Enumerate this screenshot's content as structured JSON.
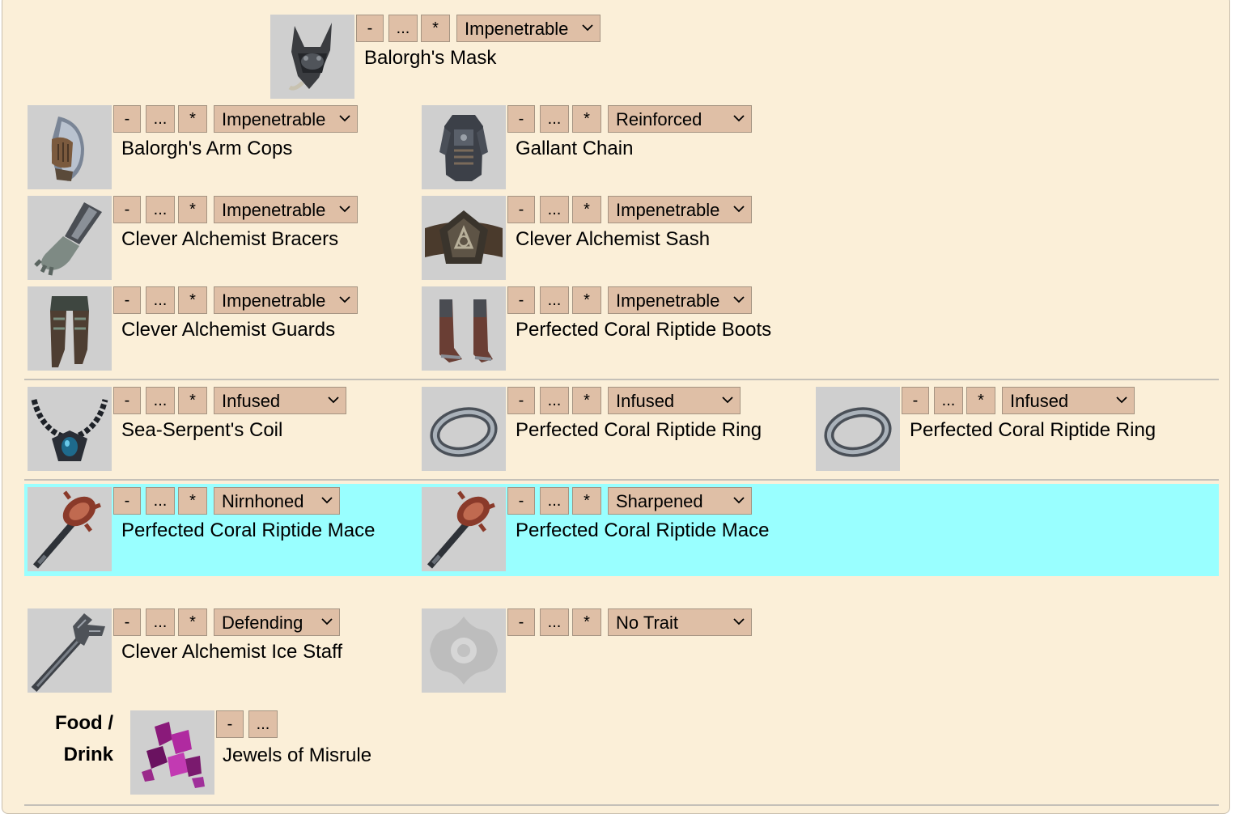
{
  "controls": {
    "remove_label": "-",
    "more_label": "...",
    "star_label": "*"
  },
  "slots": {
    "head": {
      "name": "Balorgh's Mask",
      "trait": "Impenetrable",
      "icon": "mask-icon"
    },
    "shoulders": {
      "name": "Balorgh's Arm Cops",
      "trait": "Impenetrable",
      "icon": "pauldron-icon"
    },
    "chest": {
      "name": "Gallant Chain",
      "trait": "Reinforced",
      "icon": "chest-armor-icon"
    },
    "hands": {
      "name": "Clever Alchemist Bracers",
      "trait": "Impenetrable",
      "icon": "gauntlet-icon"
    },
    "waist": {
      "name": "Clever Alchemist Sash",
      "trait": "Impenetrable",
      "icon": "belt-icon"
    },
    "legs": {
      "name": "Clever Alchemist Guards",
      "trait": "Impenetrable",
      "icon": "greaves-icon"
    },
    "feet": {
      "name": "Perfected Coral Riptide Boots",
      "trait": "Impenetrable",
      "icon": "boots-icon"
    },
    "neck": {
      "name": "Sea-Serpent's Coil",
      "trait": "Infused",
      "icon": "necklace-icon"
    },
    "ring1": {
      "name": "Perfected Coral Riptide Ring",
      "trait": "Infused",
      "icon": "ring-icon"
    },
    "ring2": {
      "name": "Perfected Coral Riptide Ring",
      "trait": "Infused",
      "icon": "ring-icon"
    },
    "main_hand": {
      "name": "Perfected Coral Riptide Mace",
      "trait": "Nirnhoned",
      "icon": "mace-icon"
    },
    "off_hand": {
      "name": "Perfected Coral Riptide Mace",
      "trait": "Sharpened",
      "icon": "mace-icon"
    },
    "backbar": {
      "name": "Clever Alchemist Ice Staff",
      "trait": "Defending",
      "icon": "staff-icon"
    },
    "backbar_off": {
      "name": "",
      "trait": "No Trait",
      "icon": "empty-slot-icon"
    }
  },
  "food": {
    "label": "Food / Drink",
    "name": "Jewels of Misrule",
    "icon": "gems-icon"
  },
  "colors": {
    "panel_background": "#fbefd8",
    "button_background": "#dfbfa6",
    "highlight_row": "#99ffff",
    "thumbnail_background": "#cfcfcf"
  }
}
